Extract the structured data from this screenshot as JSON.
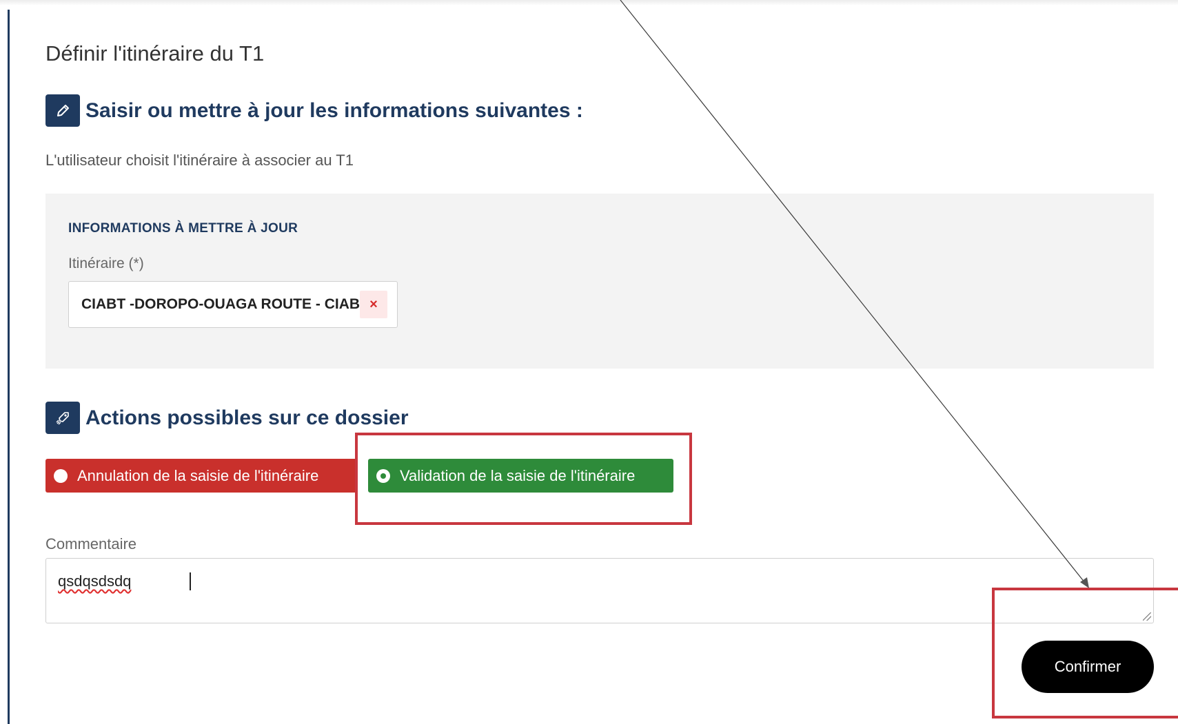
{
  "page": {
    "title": "Définir l'itinéraire du T1"
  },
  "edit_section": {
    "title": "Saisir ou mettre à jour les informations suivantes :",
    "icon": "pencil-icon",
    "description": "L'utilisateur choisit l'itinéraire à associer au T1"
  },
  "info_panel": {
    "heading": "INFORMATIONS À METTRE À JOUR",
    "itinerary_label": "Itinéraire (*)",
    "itinerary_value": "CIABT -DOROPO-OUAGA ROUTE - CIABT",
    "clear_symbol": "×"
  },
  "actions_section": {
    "title": "Actions possibles sur ce dossier",
    "icon": "rocket-icon",
    "options": [
      {
        "label": "Annulation de la saisie de l'itinéraire",
        "selected": false,
        "color": "#c9302c"
      },
      {
        "label": "Validation de la saisie de l'itinéraire",
        "selected": true,
        "color": "#2e8b3a"
      }
    ]
  },
  "comment": {
    "label": "Commentaire",
    "value": "qsdqsdsdq"
  },
  "confirm_button": {
    "label": "Confirmer"
  },
  "colors": {
    "primary": "#1f3a5f",
    "annotation": "#c8373f"
  }
}
